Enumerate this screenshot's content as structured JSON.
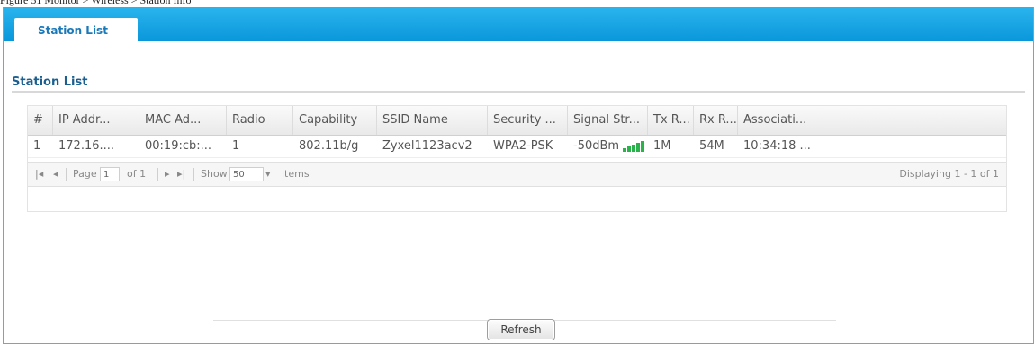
{
  "caption": "Figure 51   Monitor > Wireless > Station Info",
  "tabs": [
    {
      "label": "Station List",
      "active": true
    }
  ],
  "section_title": "Station List",
  "table": {
    "columns": [
      "#",
      "IP Addr...",
      "MAC Ad...",
      "Radio",
      "Capability",
      "SSID Name",
      "Security ...",
      "Signal Str...",
      "Tx R...",
      "Rx R...",
      "Associati..."
    ],
    "rows": [
      {
        "index": "1",
        "ip": "172.16....",
        "mac": "00:19:cb:...",
        "radio": "1",
        "capability": "802.11b/g",
        "ssid": "Zyxel1123acv2",
        "security": "WPA2-PSK",
        "signal": "-50dBm",
        "signal_level": 5,
        "tx": "1M",
        "rx": "54M",
        "associated": "10:34:18 ..."
      }
    ]
  },
  "pager": {
    "first_icon": "first-page-icon",
    "prev_icon": "prev-page-icon",
    "page_label": "Page",
    "page_value": "1",
    "of_label": "of 1",
    "next_icon": "next-page-icon",
    "last_icon": "last-page-icon",
    "show_label": "Show",
    "show_value": "50",
    "items_label": "items",
    "displaying": "Displaying 1 - 1 of 1"
  },
  "buttons": {
    "refresh": "Refresh"
  },
  "colors": {
    "tabbar": "#0a97da",
    "signal": "#2bb34b",
    "title": "#1a5f8f"
  }
}
